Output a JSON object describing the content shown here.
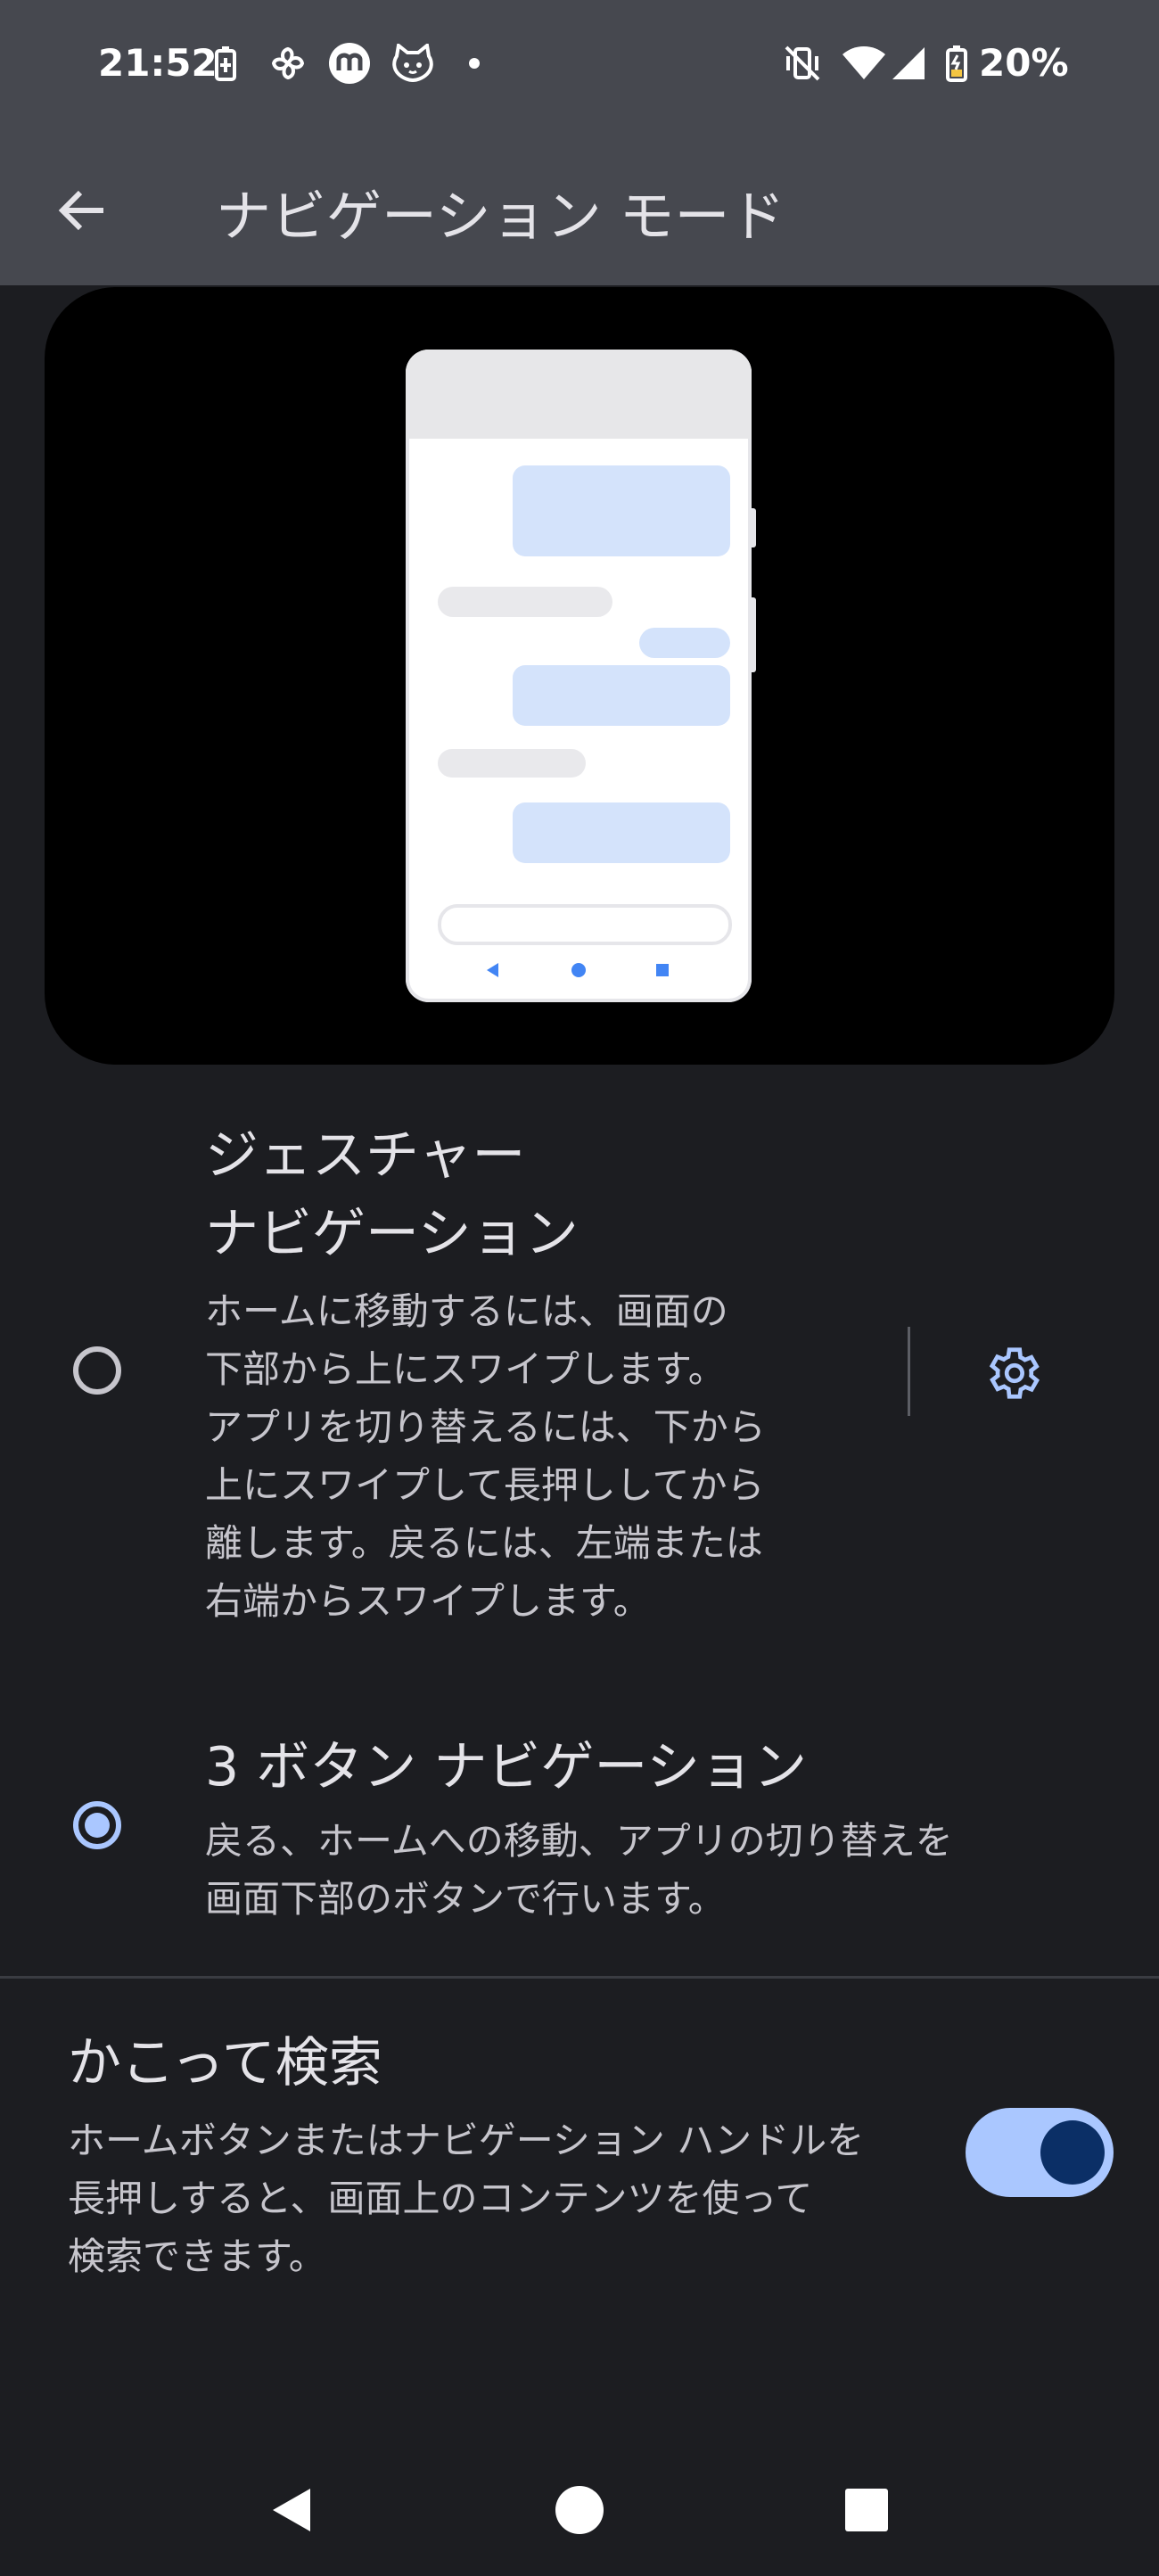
{
  "status_bar": {
    "time": "21:52",
    "battery_percent": "20%",
    "icons": [
      "battery-saver-icon",
      "pinwheel-app-icon",
      "m-app-icon",
      "cat-app-icon",
      "notification-dot-icon",
      "vibrate-off-icon",
      "wifi-icon",
      "signal-icon",
      "battery-icon"
    ]
  },
  "app_bar": {
    "title": "ナビゲーション モード"
  },
  "options": [
    {
      "title_line1": "ジェスチャー",
      "title_line2": "ナビゲーション",
      "desc_lines": [
        "ホームに移動するには、画面の",
        "下部から上にスワイプします。",
        "アプリを切り替えるには、下から",
        "上にスワイプして長押ししてから",
        "離します。戻るには、左端または",
        "右端からスワイプします。"
      ],
      "selected": false
    },
    {
      "title": "3 ボタン ナビゲーション",
      "desc_lines": [
        "戻る、ホームへの移動、アプリの切り替えを",
        "画面下部のボタンで行います。"
      ],
      "selected": true
    }
  ],
  "circle_to_search": {
    "title": "かこって検索",
    "desc_lines": [
      "ホームボタンまたはナビゲーション ハンドルを",
      "長押しすると、画面上のコンテンツを使って",
      "検索できます。"
    ],
    "enabled": true
  },
  "colors": {
    "accent": "#aac7ff",
    "background": "#1c1d21",
    "bar": "#46484f"
  }
}
